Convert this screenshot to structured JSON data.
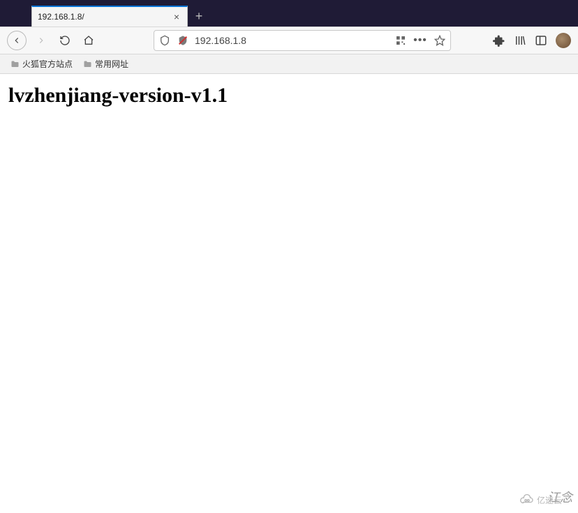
{
  "tab": {
    "title": "192.168.1.8/",
    "close_label": "×"
  },
  "new_tab": {
    "label": "+"
  },
  "address": {
    "url": "192.168.1.8"
  },
  "bookmarks": [
    {
      "label": "火狐官方站点"
    },
    {
      "label": "常用网址"
    }
  ],
  "page": {
    "heading": "lvzhenjiang-version-v1.1"
  },
  "watermark": {
    "text": "江念",
    "logo_text": "亿速云"
  },
  "icons": {
    "back": "back-icon",
    "forward": "forward-icon",
    "reload": "reload-icon",
    "home": "home-icon",
    "shield": "shield-icon",
    "blocked": "blocked-icon",
    "qr": "qr-icon",
    "menu": "more-menu-icon",
    "star": "star-icon",
    "puzzle": "extensions-icon",
    "library": "library-icon",
    "sidebar": "sidebar-icon",
    "avatar": "avatar-icon",
    "folder": "folder-icon",
    "close": "close-icon",
    "plus": "plus-icon"
  }
}
